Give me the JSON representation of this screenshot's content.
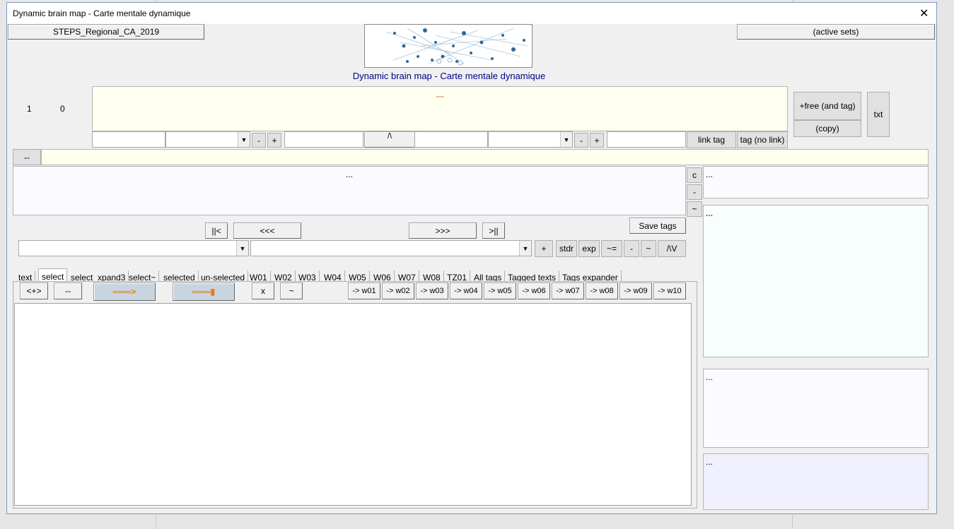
{
  "window": {
    "title": "Dynamic brain map - Carte mentale dynamique",
    "close_glyph": "✕"
  },
  "header": {
    "dataset_label": "STEPS_Regional_CA_2019",
    "active_sets_label": "(active sets)",
    "caption": "Dynamic brain map - Carte mentale dynamique"
  },
  "counters": {
    "left": "1",
    "right": "0"
  },
  "editor": {
    "placeholder_text": "---"
  },
  "tag_row": {
    "minus": "-",
    "plus": "+",
    "middle": "/\\",
    "minus2": "-",
    "plus2": "+",
    "link_tag": "link tag",
    "tag_no_link": "tag (no link)"
  },
  "side_buttons": {
    "free_tag": "+free (and tag)",
    "copy": "(copy)",
    "txt": "txt"
  },
  "dash_button": "--",
  "notes": {
    "text": "..."
  },
  "mini_buttons": {
    "c": "c",
    "minus": "-",
    "tilde": "~"
  },
  "right_panels": {
    "p1": "...",
    "p2": "...",
    "p3": "...",
    "p4": "..."
  },
  "nav": {
    "first": "||<",
    "prev": "<<<",
    "next": ">>>",
    "last": ">||",
    "save_tags": "Save tags"
  },
  "filter_buttons": [
    "+",
    "stdr",
    "exp",
    "~=",
    "-",
    "~",
    "/\\V"
  ],
  "tabs": [
    "text",
    "select",
    "select_xpand3",
    "select~",
    "selected",
    "un-selected",
    "W01",
    "W02",
    "W03",
    "W04",
    "W05",
    "W06",
    "W07",
    "W08",
    "TZ01",
    "All tags",
    "Tagged texts",
    "Tags expander"
  ],
  "active_tab": "select",
  "select_toolbar": {
    "expand": "<+>",
    "dash": "--",
    "arrow": "═══>",
    "arrow_end": "═══▮",
    "x": "x",
    "tilde": "~"
  },
  "word_buttons": [
    "-> w01",
    "-> w02",
    "-> w03",
    "-> w04",
    "-> w05",
    "-> w06",
    "-> w07",
    "-> w08",
    "-> w09",
    "-> w10"
  ],
  "colors": {
    "accent_text": "#000080",
    "arrow": "#f07800",
    "editor_bg": "#fffff0"
  }
}
